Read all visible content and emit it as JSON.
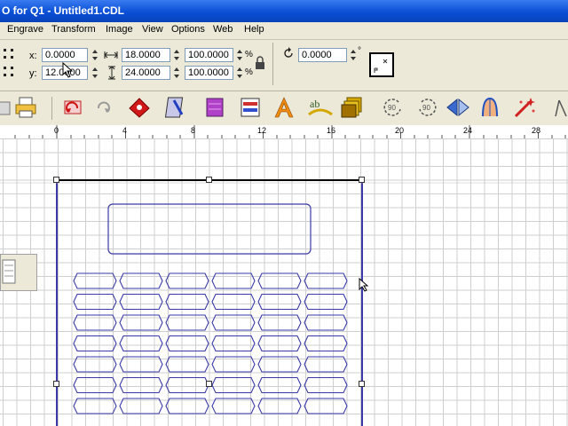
{
  "window": {
    "title": "O for Q1 - Untitled1.CDL"
  },
  "menu": [
    "Engrave",
    "Transform",
    "Image",
    "View",
    "Options",
    "Web",
    "Help"
  ],
  "properties": {
    "x_label": "x:",
    "x_value": "0.0000",
    "y_label": "y:",
    "y_value": "12.0000",
    "width_value": "18.0000",
    "height_value": "24.0000",
    "scale_w_value": "100.0000",
    "scale_h_value": "100.0000",
    "percent_sign": "%",
    "rotation_value": "0.0000",
    "degree_sign": "°"
  },
  "ruler": {
    "labels": [
      "0",
      "4",
      "8",
      "12",
      "16",
      "20",
      "24",
      "28"
    ]
  },
  "colors": {
    "title_bar": "#0a4fd6",
    "shape_outline": "#3a3aa8",
    "grid": "#cfcfcf"
  }
}
